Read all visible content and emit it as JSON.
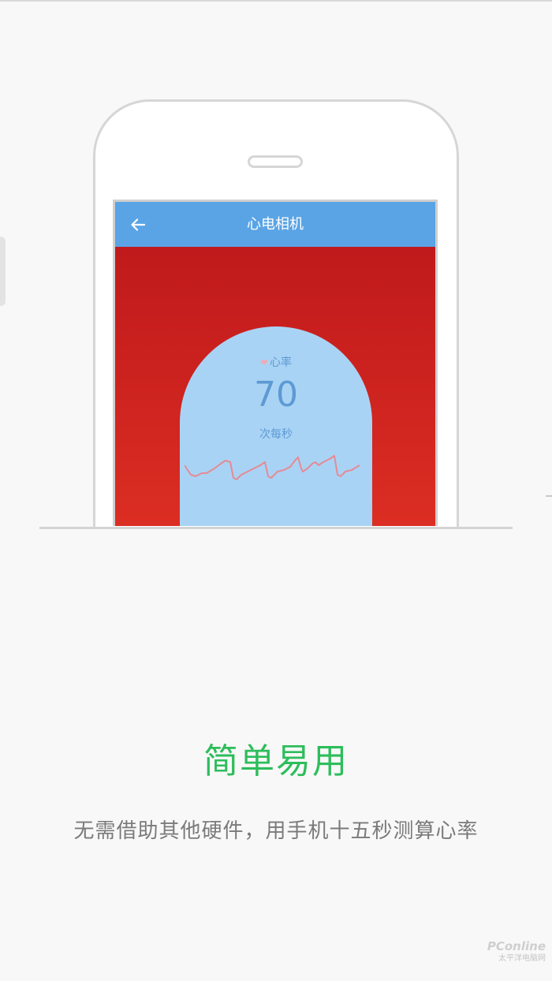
{
  "app": {
    "title": "心电相机",
    "back_icon": "arrow-left-icon",
    "bar_color": "#5aa4e5"
  },
  "heart_rate": {
    "label": "心率",
    "icon": "heart-icon",
    "value": "70",
    "unit": "次每秒"
  },
  "feature": {
    "title": "简单易用",
    "description": "无需借助其他硬件，用手机十五秒测算心率",
    "title_color": "#2dbd5b"
  },
  "watermark": {
    "brand": "PConline",
    "sub": "太平洋电脑网"
  }
}
